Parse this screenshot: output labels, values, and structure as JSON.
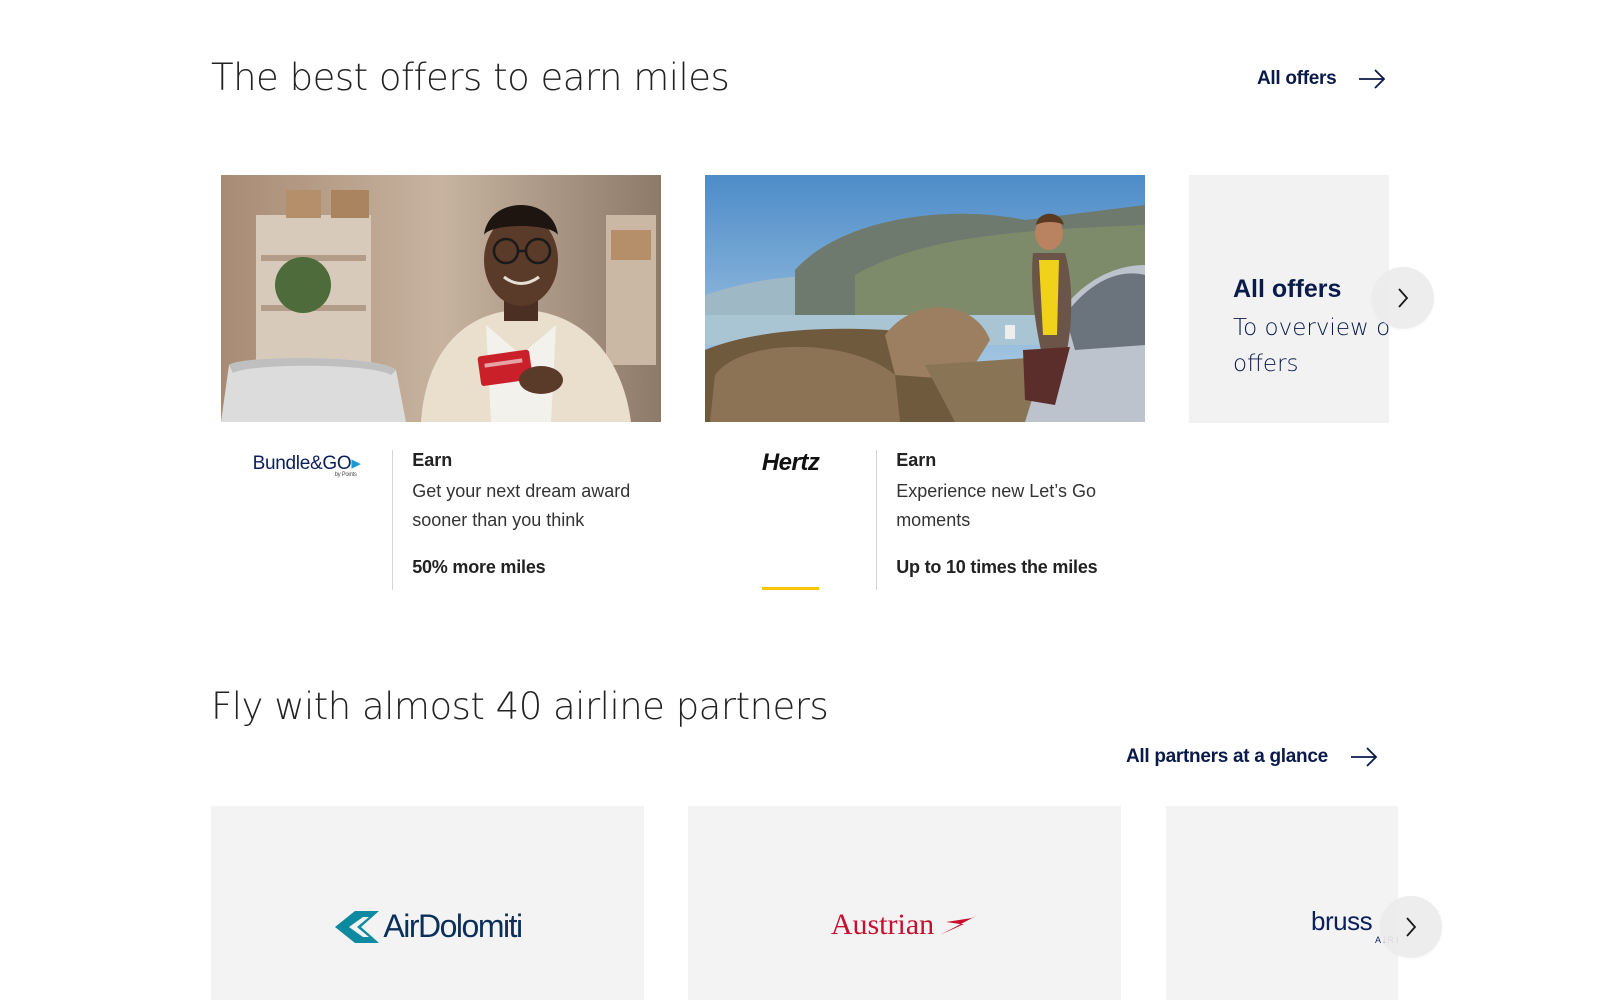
{
  "offers_section": {
    "title": "The best offers to earn miles",
    "all_link": "All offers",
    "cards": [
      {
        "partner": "Bundle&GO",
        "partner_sub": "by Points",
        "kicker": "Earn",
        "description": "Get your next dream award sooner than you think",
        "benefit": "50% more miles"
      },
      {
        "partner": "Hertz",
        "kicker": "Earn",
        "description": "Experience new Let’s Go moments",
        "benefit": "Up to 10 times the miles"
      }
    ],
    "overview_tile": {
      "title": "All offers",
      "subtitle": "To overview of offers"
    }
  },
  "partners_section": {
    "title": "Fly with almost 40 airline partners",
    "all_link": "All partners at a glance",
    "airlines": [
      {
        "name": "AirDolomiti",
        "color": "#0d8aa0"
      },
      {
        "name": "Austrian",
        "color": "#c8102e"
      },
      {
        "name": "bruss",
        "sub": "AIRL",
        "color": "#0a1f5c"
      }
    ]
  },
  "icons": [
    "arrow-right-icon",
    "chevron-right-icon"
  ],
  "colors": {
    "brand_navy": "#0a1a4a",
    "tile_bg": "#f2f2f2",
    "hertz_yellow": "#f7c600"
  }
}
